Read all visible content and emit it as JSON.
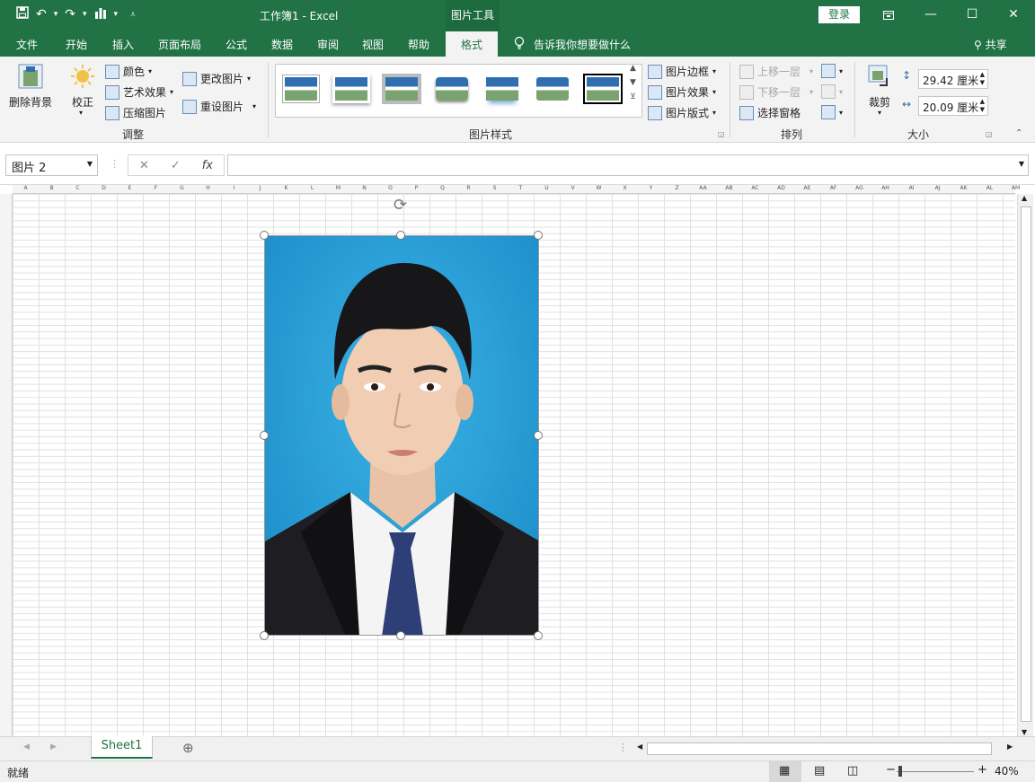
{
  "title_bar": {
    "document_title": "工作簿1  -  Excel",
    "contextual_tools": "图片工具",
    "signin": "登录",
    "qat_icons": [
      "save-icon",
      "undo-icon",
      "redo-icon",
      "chart-icon",
      "customize-icon"
    ],
    "window_controls": [
      "ribbon-display-icon",
      "minimize-icon",
      "maximize-icon",
      "close-icon"
    ]
  },
  "tabs": [
    "文件",
    "开始",
    "插入",
    "页面布局",
    "公式",
    "数据",
    "审阅",
    "视图",
    "帮助"
  ],
  "active_tab": "格式",
  "tell_me": "告诉我你想要做什么",
  "share": "共享",
  "ribbon": {
    "adjust": {
      "remove_bg": "删除背景",
      "correct": "校正",
      "color": "颜色",
      "artistic": "艺术效果",
      "compress": "压缩图片",
      "change": "更改图片",
      "reset": "重设图片",
      "label": "调整"
    },
    "styles": {
      "label": "图片样式",
      "border": "图片边框",
      "effects": "图片效果",
      "layout": "图片版式"
    },
    "arrange": {
      "label": "排列",
      "forward": "上移一层",
      "backward": "下移一层",
      "selection_pane": "选择窗格"
    },
    "size": {
      "label": "大小",
      "crop": "裁剪",
      "height": "29.42 厘米",
      "width": "20.09 厘米"
    }
  },
  "formula_bar": {
    "name_box": "图片 2",
    "fx": "fx",
    "content": ""
  },
  "columns": [
    "A",
    "B",
    "C",
    "D",
    "E",
    "F",
    "G",
    "H",
    "I",
    "J",
    "K",
    "L",
    "M",
    "N",
    "O",
    "P",
    "Q",
    "R",
    "S",
    "T",
    "U",
    "V",
    "W",
    "X",
    "Y",
    "Z",
    "AA",
    "AB",
    "AC",
    "AD",
    "AE",
    "AF",
    "AG",
    "AH",
    "AI",
    "AJ",
    "AK",
    "AL",
    "AM"
  ],
  "sheet_tabs": [
    "Sheet1"
  ],
  "status": {
    "ready": "就绪",
    "zoom": "40%"
  }
}
